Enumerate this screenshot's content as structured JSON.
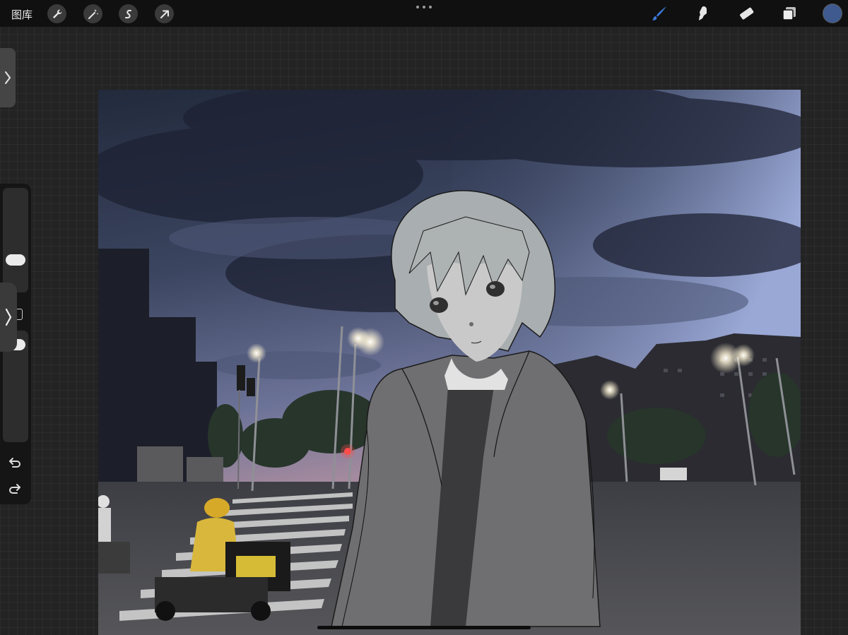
{
  "toolbar": {
    "gallery_label": "图库",
    "left_tools": [
      "wrench-icon",
      "magic-wand-icon",
      "selection-icon",
      "transform-arrow-icon"
    ],
    "more_menu": "more-dots-icon",
    "right_tools": [
      "brush-icon",
      "smudge-icon",
      "eraser-icon",
      "layers-icon"
    ],
    "active_tool": "brush-icon",
    "active_tool_color": "#3d7bdc",
    "current_color": "#3f5a8f"
  },
  "sidebar": {
    "brush_size_level": 0.55,
    "opacity_level": 0.22,
    "undo_icon": "undo-icon",
    "redo_icon": "redo-icon"
  },
  "canvas": {
    "description_colors": {
      "sky_top": "#2c3346",
      "sky_bottom": "#7c89b5",
      "road": "#4b4b4e",
      "figure_gray": "#8a8a8a"
    }
  }
}
